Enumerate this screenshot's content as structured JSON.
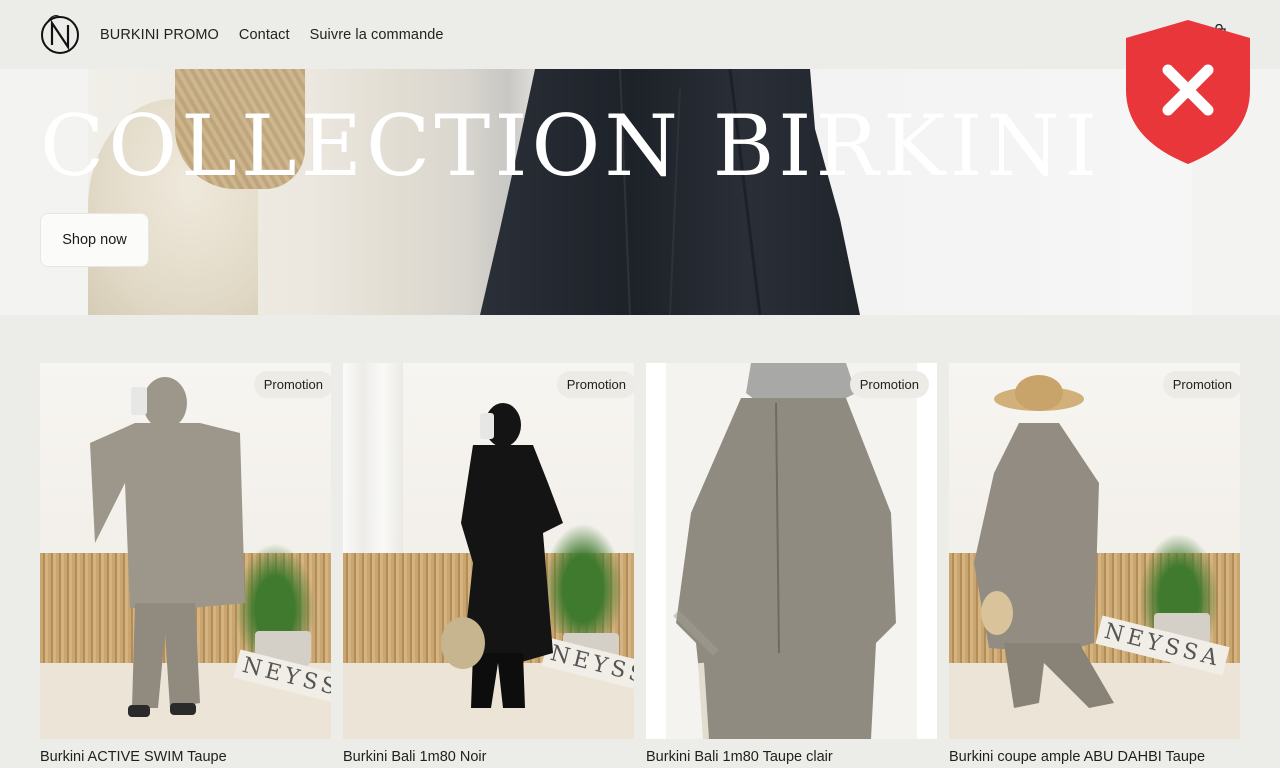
{
  "header": {
    "logo_letter": "N",
    "nav": [
      "BURKINI PROMO",
      "Contact",
      "Suivre la commande"
    ]
  },
  "hero": {
    "title": "COLLECTION BIRKINI",
    "button_label": "Shop now"
  },
  "products": [
    {
      "name": "Burkini ACTIVE SWIM Taupe",
      "badge": "Promotion",
      "garment_color": "#9d968b"
    },
    {
      "name": "Burkini Bali 1m80 Noir",
      "badge": "Promotion",
      "garment_color": "#141414"
    },
    {
      "name": "Burkini Bali 1m80 Taupe clair",
      "badge": "Promotion",
      "garment_color": "#8f8b80"
    },
    {
      "name": "Burkini coupe ample ABU DAHBI Taupe",
      "badge": "Promotion",
      "garment_color": "#928c82"
    }
  ],
  "colors": {
    "background": "#ecece8",
    "shield_red": "#e8363b"
  },
  "icons": {
    "cart": "cart-icon",
    "alert": "security-shield-x-icon"
  }
}
